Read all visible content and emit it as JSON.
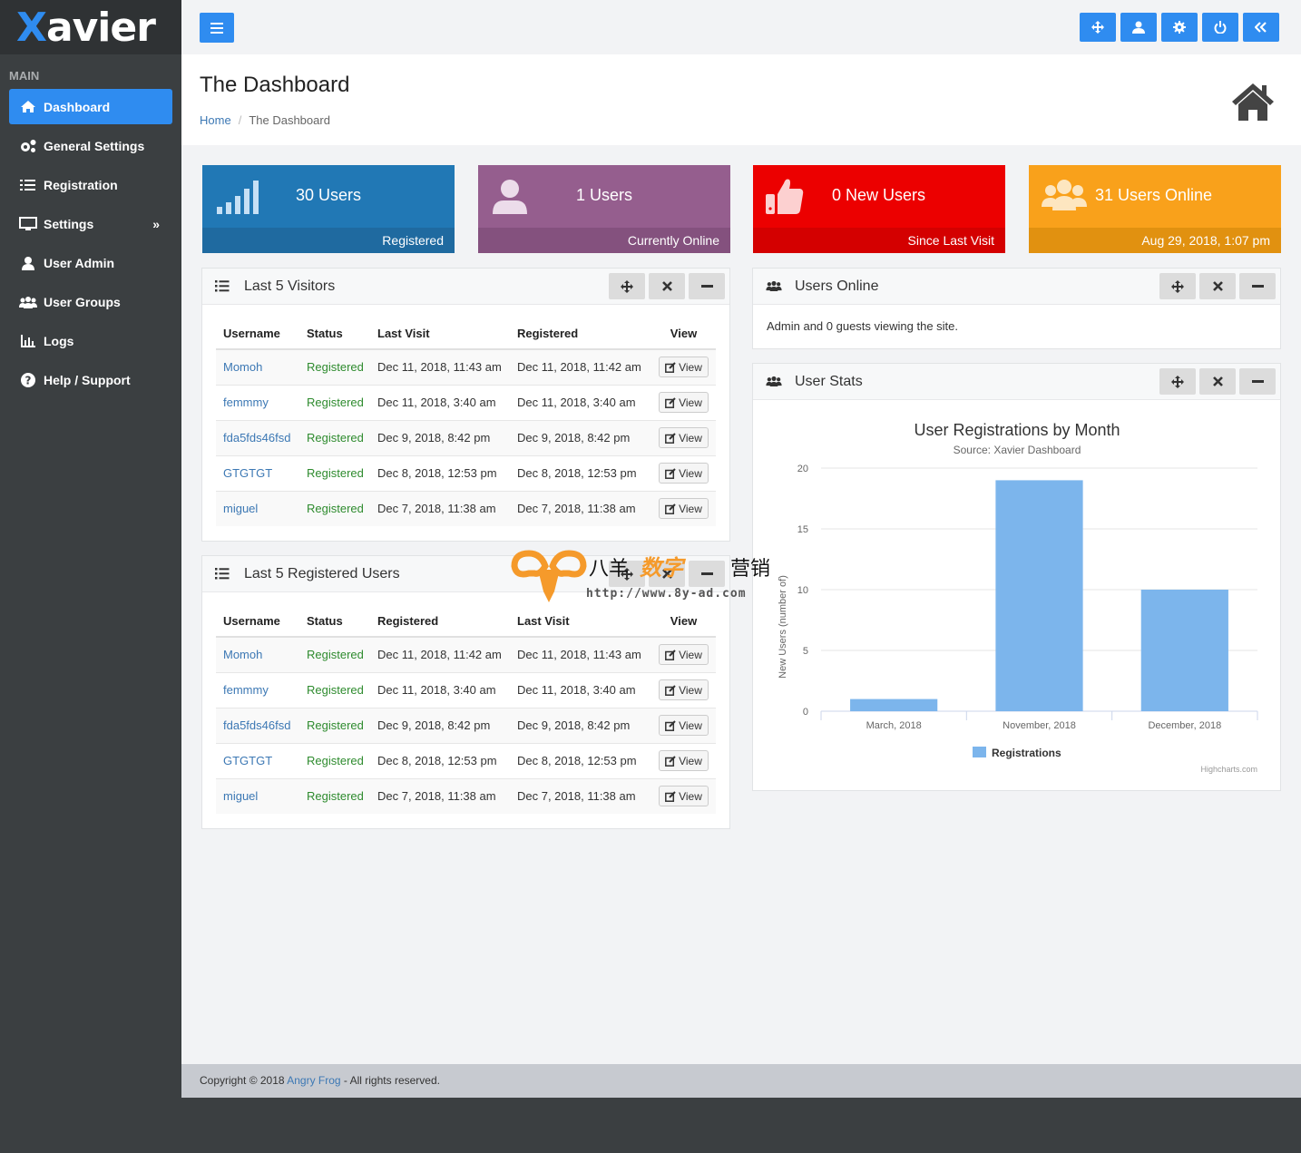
{
  "app": {
    "logo_first": "X",
    "logo_rest": "avier"
  },
  "sidebar": {
    "section": "MAIN",
    "items": [
      {
        "label": "Dashboard",
        "icon": "home-icon",
        "active": true
      },
      {
        "label": "General Settings",
        "icon": "cogs-icon"
      },
      {
        "label": "Registration",
        "icon": "list-check-icon"
      },
      {
        "label": "Settings",
        "icon": "monitor-icon",
        "chevron": "»"
      },
      {
        "label": "User Admin",
        "icon": "user-icon"
      },
      {
        "label": "User Groups",
        "icon": "users-icon"
      },
      {
        "label": "Logs",
        "icon": "bar-chart-icon"
      },
      {
        "label": "Help / Support",
        "icon": "question-circle-icon"
      }
    ]
  },
  "topbar": {
    "buttons": [
      "move-icon",
      "user-icon",
      "gear-icon",
      "power-icon",
      "double-chevron-left-icon"
    ]
  },
  "header": {
    "title": "The Dashboard",
    "breadcrumb": {
      "home": "Home",
      "separator": "/",
      "current": "The Dashboard"
    }
  },
  "stats": [
    {
      "value": "30 Users",
      "caption": "Registered",
      "color": "#2178b5",
      "footer_color": "#1f6aa0",
      "icon": "signal-icon"
    },
    {
      "value": "1 Users",
      "caption": "Currently Online",
      "color": "#955e8e",
      "footer_color": "#84517e",
      "icon": "user-icon"
    },
    {
      "value": "0 New Users",
      "caption": "Since Last Visit",
      "color": "#ec0000",
      "footer_color": "#d40000",
      "icon": "thumbs-up-icon"
    },
    {
      "value": "31 Users Online",
      "caption": "Aug 29, 2018, 1:07 pm",
      "color": "#f9a11b",
      "footer_color": "#e19110",
      "icon": "users-icon"
    }
  ],
  "visitors": {
    "title": "Last 5 Visitors",
    "columns": [
      "Username",
      "Status",
      "Last Visit",
      "Registered",
      "View"
    ],
    "view_label": "View",
    "rows": [
      [
        "Momoh",
        "Registered",
        "Dec 11, 2018, 11:43 am",
        "Dec 11, 2018, 11:42 am"
      ],
      [
        "femmmy",
        "Registered",
        "Dec 11, 2018, 3:40 am",
        "Dec 11, 2018, 3:40 am"
      ],
      [
        "fda5fds46fsd",
        "Registered",
        "Dec 9, 2018, 8:42 pm",
        "Dec 9, 2018, 8:42 pm"
      ],
      [
        "GTGTGT",
        "Registered",
        "Dec 8, 2018, 12:53 pm",
        "Dec 8, 2018, 12:53 pm"
      ],
      [
        "miguel",
        "Registered",
        "Dec 7, 2018, 11:38 am",
        "Dec 7, 2018, 11:38 am"
      ]
    ]
  },
  "registered": {
    "title": "Last 5 Registered Users",
    "columns": [
      "Username",
      "Status",
      "Registered",
      "Last Visit",
      "View"
    ],
    "view_label": "View",
    "rows": [
      [
        "Momoh",
        "Registered",
        "Dec 11, 2018, 11:42 am",
        "Dec 11, 2018, 11:43 am"
      ],
      [
        "femmmy",
        "Registered",
        "Dec 11, 2018, 3:40 am",
        "Dec 11, 2018, 3:40 am"
      ],
      [
        "fda5fds46fsd",
        "Registered",
        "Dec 9, 2018, 8:42 pm",
        "Dec 9, 2018, 8:42 pm"
      ],
      [
        "GTGTGT",
        "Registered",
        "Dec 8, 2018, 12:53 pm",
        "Dec 8, 2018, 12:53 pm"
      ],
      [
        "miguel",
        "Registered",
        "Dec 7, 2018, 11:38 am",
        "Dec 7, 2018, 11:38 am"
      ]
    ]
  },
  "users_online": {
    "title": "Users Online",
    "text": "Admin and 0 guests viewing the site."
  },
  "user_stats": {
    "title": "User Stats"
  },
  "chart_data": {
    "type": "bar",
    "title": "User Registrations by Month",
    "subtitle": "Source: Xavier Dashboard",
    "categories": [
      "March, 2018",
      "November, 2018",
      "December, 2018"
    ],
    "series": [
      {
        "name": "Registrations",
        "values": [
          1,
          19,
          10
        ],
        "color": "#7cb5ec"
      }
    ],
    "xlabel": "",
    "ylabel": "New Users (number of)",
    "ylim": [
      0,
      20
    ],
    "yticks": [
      0,
      5,
      10,
      15,
      20
    ],
    "grid": true,
    "legend": "bottom-center",
    "credits": "Highcharts.com"
  },
  "watermark": {
    "text_cn_1": "八羊",
    "text_cn_2": "数字",
    "text_cn_3": "营销",
    "url": "http://www.8y-ad.com"
  },
  "footer": {
    "prefix": "Copyright © 2018 ",
    "link": "Angry Frog",
    "suffix": " - All rights reserved."
  }
}
